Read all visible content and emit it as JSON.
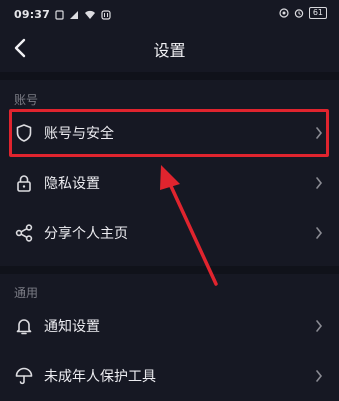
{
  "status_bar": {
    "time": "09:37",
    "battery": "61"
  },
  "nav": {
    "title": "设置"
  },
  "sections": [
    {
      "label": "账号"
    },
    {
      "label": "通用"
    }
  ],
  "rows": [
    {
      "label": "账号与安全",
      "icon": "shield-icon"
    },
    {
      "label": "隐私设置",
      "icon": "lock-icon"
    },
    {
      "label": "分享个人主页",
      "icon": "share-icon"
    },
    {
      "label": "通知设置",
      "icon": "bell-icon"
    },
    {
      "label": "未成年人保护工具",
      "icon": "umbrella-icon"
    }
  ],
  "colors": {
    "background": "#161823",
    "highlight": "#e0242e",
    "secondary_text": "#7b7c85"
  }
}
